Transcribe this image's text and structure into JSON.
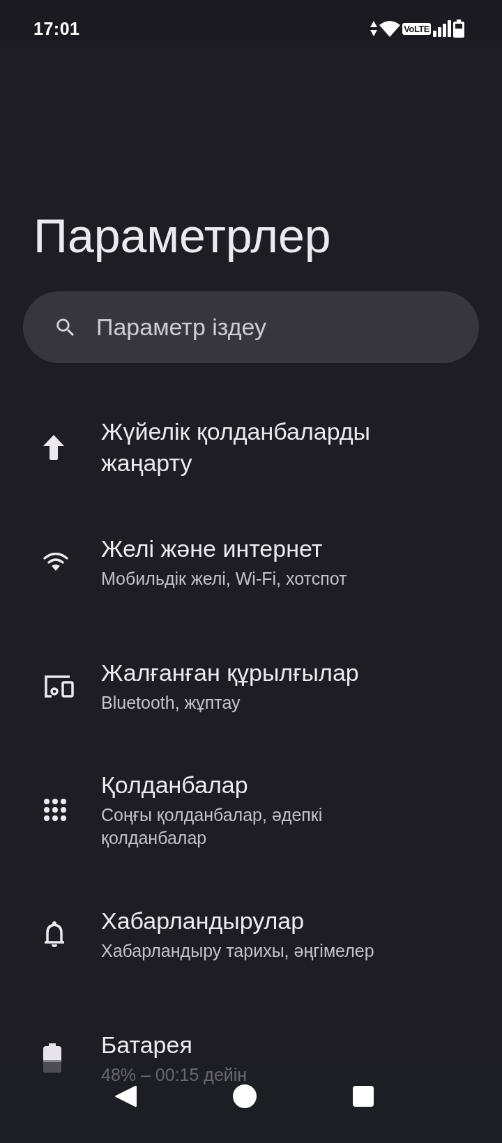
{
  "status_bar": {
    "time": "17:01",
    "volte": "VoLTE"
  },
  "header": {
    "title": "Параметрлер"
  },
  "search": {
    "placeholder": "Параметр іздеу"
  },
  "items": [
    {
      "title": "Жүйелік қолданбаларды жаңарту"
    },
    {
      "title": "Желі және интернет",
      "subtitle": "Мобильдік желі, Wi-Fi, хотспот"
    },
    {
      "title": "Жалғанған құрылғылар",
      "subtitle": "Bluetooth, жұптау"
    },
    {
      "title": "Қолданбалар",
      "subtitle": "Соңғы қолданбалар, әдепкі қолданбалар"
    },
    {
      "title": "Хабарландырулар",
      "subtitle": "Хабарландыру тарихы, әңгімелер"
    },
    {
      "title": "Батарея",
      "subtitle": "48% – 00:15 дейін"
    }
  ]
}
